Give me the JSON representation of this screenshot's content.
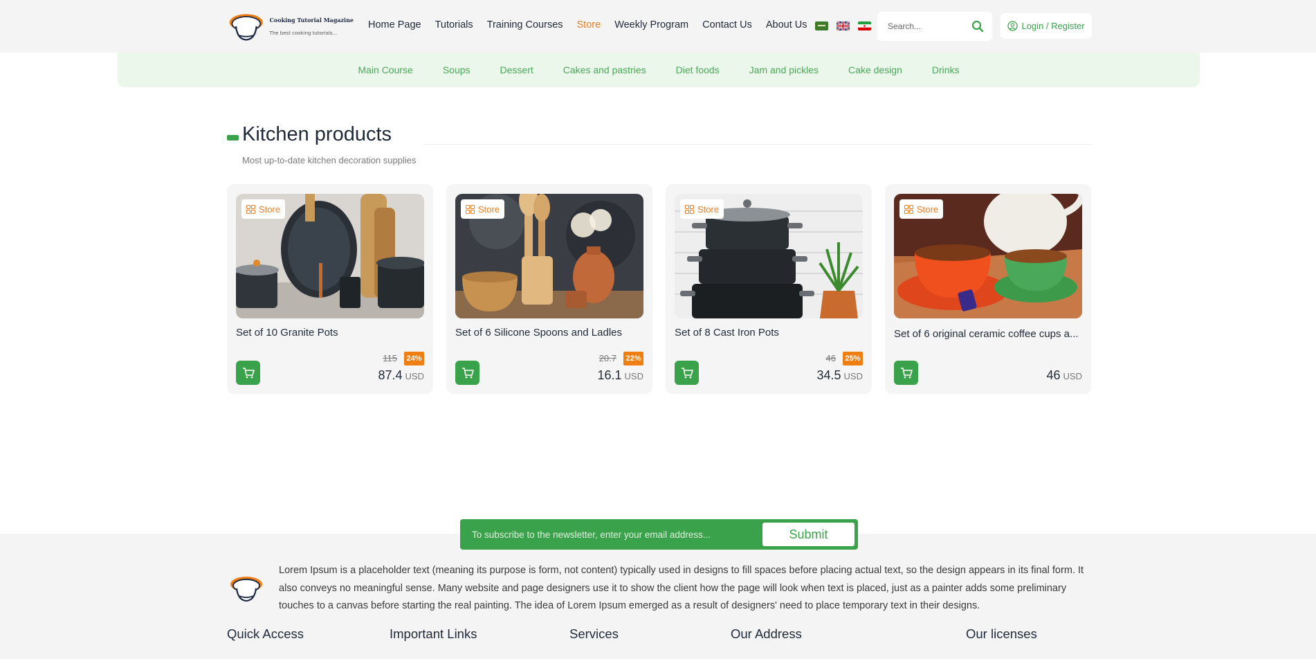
{
  "header": {
    "logo_title": "Cooking Tutorial Magazine",
    "logo_subtitle": "The best cooking tutorials...",
    "nav": [
      {
        "label": "Home Page",
        "active": false
      },
      {
        "label": "Tutorials",
        "active": false
      },
      {
        "label": "Training Courses",
        "active": false
      },
      {
        "label": "Store",
        "active": true
      },
      {
        "label": "Weekly Program",
        "active": false
      },
      {
        "label": "Contact Us",
        "active": false
      },
      {
        "label": "About Us",
        "active": false
      }
    ],
    "languages": [
      "arabic-flag-icon",
      "uk-flag-icon",
      "iran-flag-icon"
    ],
    "search_placeholder": "Search...",
    "login_label": "Login / Register"
  },
  "categories": [
    "Main Course",
    "Soups",
    "Dessert",
    "Cakes and pastries",
    "Diet foods",
    "Jam and pickles",
    "Cake design",
    "Drinks"
  ],
  "section": {
    "title": "Kitchen products",
    "subtitle": "Most up-to-date kitchen decoration supplies"
  },
  "products": [
    {
      "badge": "Store",
      "title": "Set of 10 Granite Pots",
      "old_price": "115",
      "discount": "24%",
      "price": "87.4",
      "currency": "USD"
    },
    {
      "badge": "Store",
      "title": "Set of 6 Silicone Spoons and Ladles",
      "old_price": "20.7",
      "discount": "22%",
      "price": "16.1",
      "currency": "USD"
    },
    {
      "badge": "Store",
      "title": "Set of 8 Cast Iron Pots",
      "old_price": "46",
      "discount": "25%",
      "price": "34.5",
      "currency": "USD"
    },
    {
      "badge": "Store",
      "title": "Set of 6 original ceramic coffee cups a...",
      "old_price": "",
      "discount": "",
      "price": "46",
      "currency": "USD"
    }
  ],
  "newsletter": {
    "placeholder": "To subscribe to the newsletter, enter your email address...",
    "submit_label": "Submit"
  },
  "footer": {
    "about": "Lorem Ipsum is a placeholder text (meaning its purpose is form, not content) typically used in designs to fill spaces before placing actual text, so the design appears in its final form. It also conveys no meaningful sense. Many website and page designers use it to show the client how the page will look when text is placed, just as a painter adds some preliminary touches to a canvas before starting the real painting. The idea of Lorem Ipsum emerged as a result of designers' need to place temporary text in their designs.",
    "columns": [
      "Quick Access",
      "Important Links",
      "Services",
      "Our Address",
      "Our licenses"
    ]
  },
  "colors": {
    "accent_green": "#3aa24a",
    "accent_orange": "#e67e22",
    "category_bar": "#eaf7ea"
  }
}
